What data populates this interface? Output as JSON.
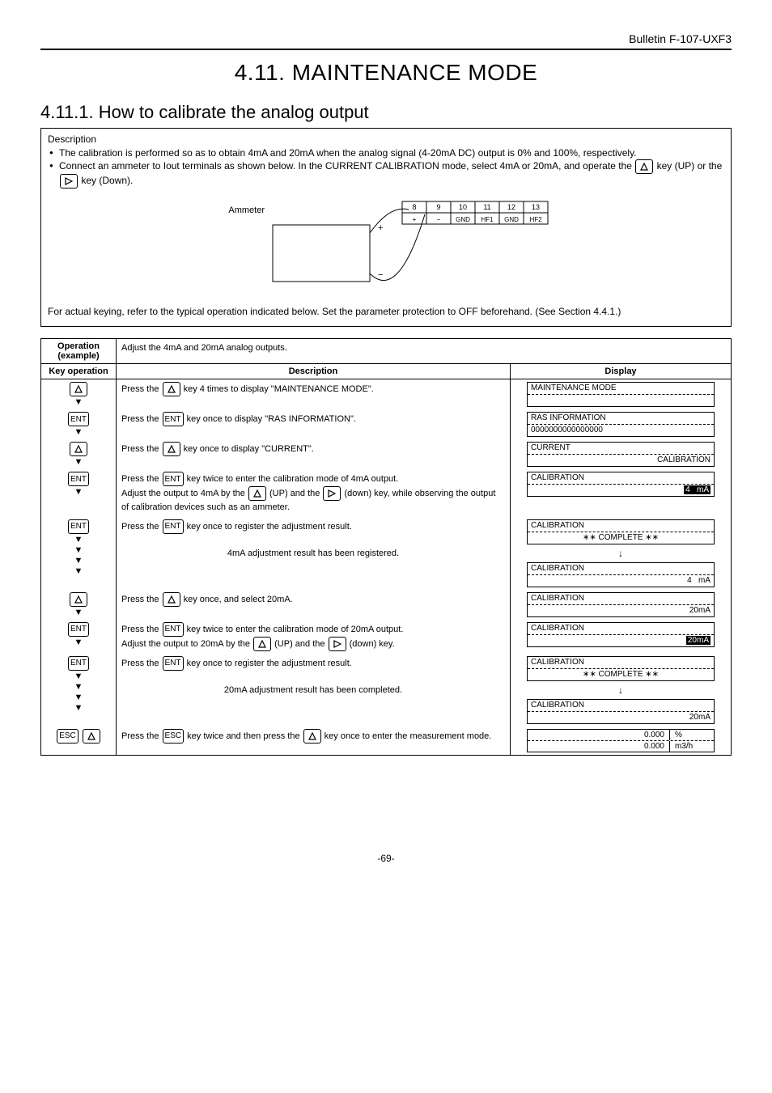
{
  "header": {
    "bulletin": "Bulletin F-107-UXF3"
  },
  "titles": {
    "h1": "4.11. MAINTENANCE MODE",
    "h2": "4.11.1. How to calibrate the analog output"
  },
  "descbox": {
    "label": "Description",
    "b1": "The calibration is performed so as to obtain 4mA and 20mA when the analog signal (4-20mA DC) output is 0% and 100%, respectively.",
    "b2_a": "Connect an ammeter to Iout terminals as shown below. In the CURRENT CALIBRATION mode, select 4mA or 20mA, and operate the ",
    "b2_b": " key (UP) or the ",
    "b2_c": " key (Down).",
    "ammeter_label": "Ammeter",
    "terminals": [
      "8",
      "9",
      "10",
      "11",
      "12",
      "13"
    ],
    "terminal_labels": [
      "+",
      "−",
      "GND",
      "HF1",
      "GND",
      "HF2"
    ],
    "polarity_plus": "+",
    "polarity_minus": "−",
    "note": "For actual keying, refer to the typical operation indicated below. Set the parameter protection to OFF beforehand. (See Section 4.4.1.)"
  },
  "table": {
    "oph": "Operation (example)",
    "oph_val": "Adjust the 4mA and 20mA analog outputs.",
    "colA": "Key operation",
    "colB": "Description",
    "colC": "Display"
  },
  "steps": {
    "s1": {
      "pre": "Press the ",
      "post": " key 4 times to display \"MAINTENANCE MODE\"."
    },
    "s2": {
      "pre": "Press the ",
      "key": "ENT",
      "post": " key once to display \"RAS INFORMATION\"."
    },
    "s3": {
      "pre": "Press the ",
      "post": " key once to display \"CURRENT\"."
    },
    "s4a": {
      "pre": "Press the ",
      "key": "ENT",
      "post": " key twice to enter the calibration mode of 4mA output."
    },
    "s4b_a": "Adjust the output to 4mA by the ",
    "s4b_b": " (UP) and the ",
    "s4b_c": " (down) key, while observing the output of calibration devices such as an ammeter.",
    "s5": {
      "pre": "Press the ",
      "key": "ENT",
      "post": " key once to register the adjustment result."
    },
    "s5b": "4mA adjustment result has been registered.",
    "s6": {
      "pre": "Press the ",
      "post": " key once, and select 20mA."
    },
    "s7a": {
      "pre": "Press the ",
      "key": "ENT",
      "post": " key twice to enter the calibration mode of 20mA output."
    },
    "s7b_a": "Adjust the output to 20mA by the ",
    "s7b_b": " (UP) and the ",
    "s7b_c": " (down) key.",
    "s8": {
      "pre": "Press the ",
      "key": "ENT",
      "post": " key once to register the adjustment result."
    },
    "s8b": "20mA adjustment result has been completed.",
    "s9_a": "Press the ",
    "s9_b": " key twice and then press the ",
    "s9_c": " key once to enter the measurement mode."
  },
  "keys": {
    "ent": "ENT",
    "esc": "ESC"
  },
  "lcd": {
    "maint": "MAINTENANCE MODE",
    "ras1": "RAS INFORMATION",
    "ras2": "0000000000000000",
    "current": "CURRENT",
    "calibration": "CALIBRATION",
    "four_ma_inv": "4   mA",
    "complete": "∗∗ COMPLETE ∗∗",
    "four_ma": "4   mA",
    "twenty": "20mA",
    "twenty_inv": "20mA",
    "meas_v1": "0.000",
    "meas_u1": "%",
    "meas_v2": "0.000",
    "meas_u2": "m3/h"
  },
  "footer": {
    "page": "-69-"
  }
}
